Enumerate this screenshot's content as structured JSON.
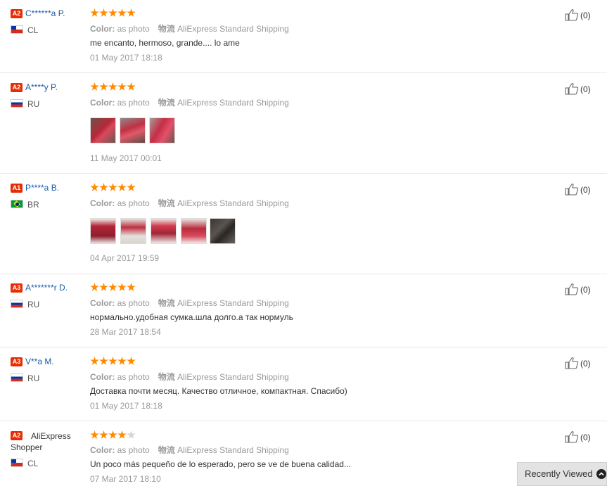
{
  "meta_labels": {
    "color_label": "Color:",
    "logistics_label": "物流"
  },
  "reviews": [
    {
      "level": "A2",
      "name": "C******a P.",
      "country": "CL",
      "rating": 5,
      "color_value": "as photo",
      "shipping": "AliExpress Standard Shipping",
      "text": "me encanto, hermoso, grande.... lo ame",
      "date": "01 May 2017 18:18",
      "helpful": "(0)"
    },
    {
      "level": "A2",
      "name": "A****y P.",
      "country": "RU",
      "rating": 5,
      "color_value": "as photo",
      "shipping": "AliExpress Standard Shipping",
      "text": "",
      "date": "11 May 2017 00:01",
      "helpful": "(0)"
    },
    {
      "level": "A1",
      "name": "P****a B.",
      "country": "BR",
      "rating": 5,
      "color_value": "as photo",
      "shipping": "AliExpress Standard Shipping",
      "text": "",
      "date": "04 Apr 2017 19:59",
      "helpful": "(0)"
    },
    {
      "level": "A3",
      "name": "A*******r D.",
      "country": "RU",
      "rating": 5,
      "color_value": "as photo",
      "shipping": "AliExpress Standard Shipping",
      "text": "нормально.удобная сумка.шла долго.а так нормуль",
      "date": "28 Mar 2017 18:54",
      "helpful": "(0)"
    },
    {
      "level": "A3",
      "name": "V**a M.",
      "country": "RU",
      "rating": 5,
      "color_value": "as photo",
      "shipping": "AliExpress Standard Shipping",
      "text": "Доставка почти месяц. Качество отличное, компактная. Спасибо)",
      "date": "01 May 2017 18:18",
      "helpful": "(0)"
    },
    {
      "level": "A2",
      "name": "AliExpress Shopper",
      "country": "CL",
      "rating": 4,
      "color_value": "as photo",
      "shipping": "AliExpress Standard Shipping",
      "text": "Un poco más pequeño de lo esperado, pero se ve de buena calidad...",
      "date": "07 Mar 2017 18:10",
      "helpful": "(0)"
    }
  ],
  "recently_viewed": {
    "label": "Recently Viewed"
  },
  "icons": {
    "star": "star-icon",
    "thumbs_up": "thumbs-up-icon",
    "chevron": "chevron-up-icon"
  },
  "colors": {
    "accent_star": "#ff8a00",
    "level_badge": "#e62e04",
    "username_link": "#1a5aa8"
  }
}
